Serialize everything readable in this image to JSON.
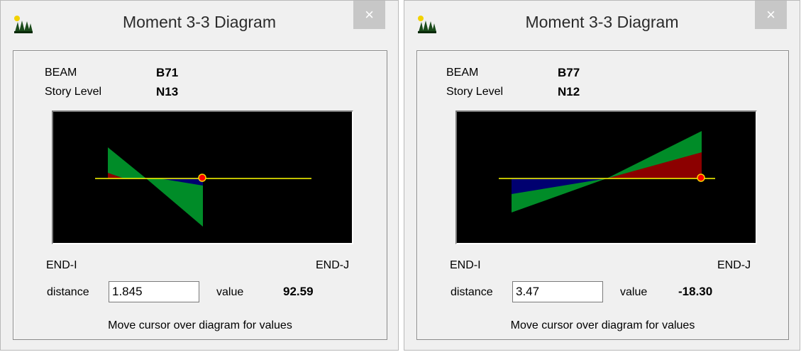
{
  "windows": [
    {
      "title": "Moment 3-3 Diagram",
      "close_glyph": "×",
      "app_icon": "sap2000-app-icon",
      "beam_label": "BEAM",
      "beam_value": "B71",
      "story_label": "Story Level",
      "story_value": "N13",
      "end_i": "END-I",
      "end_j": "END-J",
      "distance_label": "distance",
      "distance_value": "1.845",
      "value_label": "value",
      "value_value": "92.59",
      "hint": "Move cursor over diagram for values",
      "colors": {
        "baseline": "#ffff00",
        "positive": "#008c28",
        "red": "#8c0000",
        "blue": "#000070",
        "marker": "#ff0000",
        "marker_ring": "#ffd200"
      }
    },
    {
      "title": "Moment 3-3 Diagram",
      "close_glyph": "×",
      "app_icon": "sap2000-app-icon",
      "beam_label": "BEAM",
      "beam_value": "B77",
      "story_label": "Story Level",
      "story_value": "N12",
      "end_i": "END-I",
      "end_j": "END-J",
      "distance_label": "distance",
      "distance_value": "3.47",
      "value_label": "value",
      "value_value": "-18.30",
      "hint": "Move cursor over diagram for values",
      "colors": {
        "baseline": "#ffff00",
        "positive": "#008c28",
        "red": "#8c0000",
        "blue": "#000070",
        "marker": "#ff0000",
        "marker_ring": "#ffd200"
      }
    }
  ]
}
